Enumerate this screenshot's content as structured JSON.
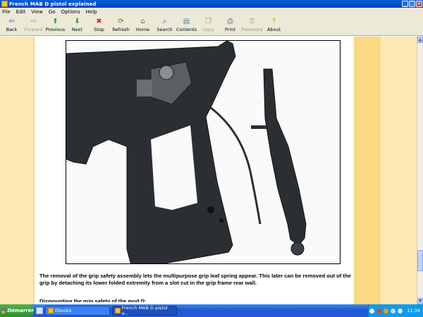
{
  "window": {
    "title": "French MAB D pistol explained",
    "controls": [
      "_",
      "□",
      "×"
    ]
  },
  "menu": [
    "File",
    "Edit",
    "View",
    "Go",
    "Options",
    "Help"
  ],
  "toolbar": [
    {
      "label": "Back",
      "icon": "back-arrow-icon",
      "glyph": "⇦",
      "color": "#1e56c6",
      "enabled": true
    },
    {
      "label": "Forward",
      "icon": "forward-arrow-icon",
      "glyph": "⇨",
      "color": "#9c9a8e",
      "enabled": false
    },
    {
      "label": "Previous",
      "icon": "up-arrow-icon",
      "glyph": "⬆",
      "color": "#2f9a2c",
      "enabled": true
    },
    {
      "label": "Next",
      "icon": "down-arrow-icon",
      "glyph": "⬇",
      "color": "#2f9a2c",
      "enabled": true
    },
    {
      "label": "Stop",
      "icon": "stop-icon",
      "glyph": "✖",
      "color": "#d22a2a",
      "enabled": true
    },
    {
      "label": "Refresh",
      "icon": "refresh-icon",
      "glyph": "⟳",
      "color": "#3a8a30",
      "enabled": true
    },
    {
      "label": "Home",
      "icon": "home-icon",
      "glyph": "⌂",
      "color": "#8a6a2a",
      "enabled": true
    },
    {
      "label": "Search",
      "icon": "search-icon",
      "glyph": "⌕",
      "color": "#555555",
      "enabled": true
    },
    {
      "label": "Contents",
      "icon": "contents-icon",
      "glyph": "▤",
      "color": "#5a7bb3",
      "enabled": true
    },
    {
      "label": "Copy",
      "icon": "copy-icon",
      "glyph": "❐",
      "color": "#9c9a8e",
      "enabled": false
    },
    {
      "label": "Print",
      "icon": "print-icon",
      "glyph": "⎙",
      "color": "#444444",
      "enabled": true
    },
    {
      "label": "Password",
      "icon": "password-icon",
      "glyph": "⚿",
      "color": "#9c9a8e",
      "enabled": false
    },
    {
      "label": "About",
      "icon": "about-icon",
      "glyph": "?",
      "color": "#c8a214",
      "enabled": true
    }
  ],
  "content": {
    "caption": "The removal of the grip safety assembly lets the multipurpose grip leaf spring appear. This later can be removed out of the grip by detaching its lower folded extremity from a slot cut in the grip frame rear wall.",
    "caption_next": "Dismounting the grip safety of the mod.D:"
  },
  "taskbar": {
    "start_label": "Démarrer",
    "tasks": [
      {
        "label": "Ebooks"
      },
      {
        "label": "French MAB D pistol e..."
      }
    ],
    "clock": "11:34"
  },
  "colors": {
    "page_sidebar": "#fde9b4",
    "page_sidebar_dark": "#f9d982",
    "titlebar": "#0a5fd8",
    "taskbar": "#2558d3"
  }
}
